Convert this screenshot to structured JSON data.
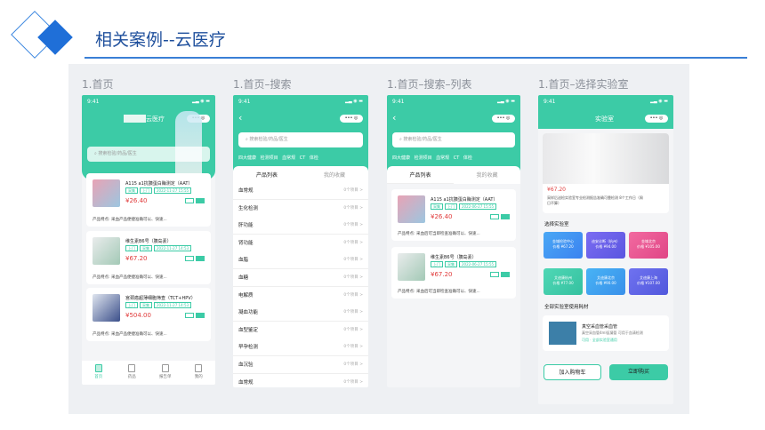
{
  "header": {
    "title": "相关案例--云医疗"
  },
  "colors": {
    "accent": "#3ccba6",
    "title": "#1e4f9c",
    "price": "#e03a3a"
  },
  "screens": [
    {
      "label": "1.首页",
      "status": "9:41",
      "app_title": "云医疗",
      "search_placeholder": "搜索检验/药品/医生",
      "cards": [
        {
          "title": "A115 a1抗胰蛋白酶测定（AAT）",
          "tags": [
            "采集",
            "上门",
            "2022-11-27 15:55"
          ],
          "price": "¥26.40",
          "desc": "产品特点: 采血产品便捷准确可以、快速..."
        },
        {
          "title": "维生素B6号（胰岛素）",
          "tags": [
            "上门",
            "采集",
            "2022-11-27 14:53"
          ],
          "price": "¥67.20",
          "desc": "产品特点: 采血产品便捷准确可以、快速..."
        },
        {
          "title": "宫颈癌超薄细胞筛查（TCT+HPV）",
          "tags": [
            "上门",
            "采集",
            "2022-11-27 14:53"
          ],
          "price": "¥504.00",
          "desc": "产品特点: 采血产品便捷准确可以、快速..."
        }
      ],
      "tabbar": [
        "首页",
        "药品",
        "报告单",
        "我的"
      ]
    },
    {
      "label": "1.首页–搜索",
      "status": "9:41",
      "search_placeholder": "搜索检验/药品/医生",
      "hot": "四大健康 检测项目 血常规 CT 体检",
      "tabs": [
        "产品列表",
        "我的收藏"
      ],
      "rows": [
        "血常规",
        "生化检测",
        "肝功能",
        "肾功能",
        "血脂",
        "血糖",
        "电解质",
        "凝血功能",
        "血型鉴定",
        "早孕检测",
        "血沉验",
        "血常规"
      ],
      "row_count": "0个项目 >"
    },
    {
      "label": "1.首页–搜索–列表",
      "status": "9:41",
      "search_placeholder": "搜索检验/药品/医生",
      "hot": "四大健康 检测项目 血常规 CT 体检",
      "tabs": [
        "产品列表",
        "我的收藏"
      ],
      "cards": [
        {
          "title": "A115 a1抗胰蛋白酶测定（AAT）",
          "tags": [
            "采集",
            "上门",
            "2022-06-27 15:55"
          ],
          "price": "¥26.40",
          "desc": "产品特点: 采血后可当即检查准确可以、快速..."
        },
        {
          "title": "维生素B6号（胰岛素）",
          "tags": [
            "上门",
            "采集",
            "2022-06-27 15:55"
          ],
          "price": "¥67.20",
          "desc": "产品特点: 采血后可当即检查准确可以、快速..."
        }
      ]
    },
    {
      "label": "1.首页–选择实验室",
      "status": "9:41",
      "app_title": "实验室",
      "price": "¥67.20",
      "desc": "采样后送检实验室专业检测报告准确可靠检测 8个工作日（周日不算）",
      "section_lab": "选择实验室",
      "labs": [
        {
          "name": "金域检验中心",
          "price": "价格 ¥67.20"
        },
        {
          "name": "迪安诊断（杭州）",
          "price": "价格 ¥94.00"
        },
        {
          "name": "金域北京",
          "price": "价格 ¥105.00"
        },
        {
          "name": "艾迪康杭州",
          "price": "价格 ¥77.00"
        },
        {
          "name": "艾迪康北京",
          "price": "价格 ¥90.00"
        },
        {
          "name": "艾迪康上海",
          "price": "价格 ¥107.00"
        }
      ],
      "section_supplies": "全部实验室使用耗材",
      "supply": {
        "title": "真空采血管采血管",
        "desc": "真空采血管4ml促凝管 可用于血清检测",
        "meta": "可用 · 全部实验室通用"
      },
      "add_cart": "加入购物车",
      "buy": "立即购买"
    }
  ]
}
